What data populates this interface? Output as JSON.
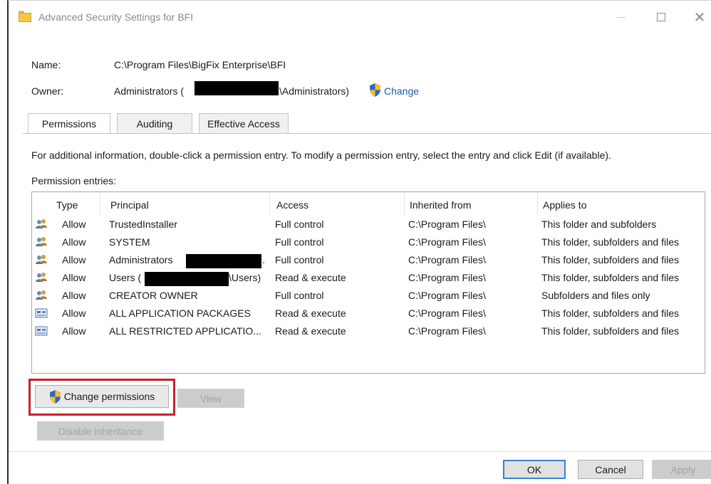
{
  "window": {
    "title": "Advanced Security Settings for BFI",
    "controls": {
      "minimize_icon": "minimize-icon",
      "maximize_icon": "maximize-icon",
      "close_icon": "close-icon",
      "close_glyph": "✕"
    }
  },
  "info": {
    "name_label": "Name:",
    "name_value": "C:\\Program Files\\BigFix Enterprise\\BFI",
    "owner_label": "Owner:",
    "owner_prefix": "Administrators (",
    "owner_suffix": "\\Administrators)",
    "change_link": "Change"
  },
  "tabs": [
    {
      "label": "Permissions",
      "selected": true
    },
    {
      "label": "Auditing",
      "selected": false
    },
    {
      "label": "Effective Access",
      "selected": false
    }
  ],
  "instructions": "For additional information, double-click a permission entry. To modify a permission entry, select the entry and click Edit (if available).",
  "entries_label": "Permission entries:",
  "table": {
    "columns": [
      "Type",
      "Principal",
      "Access",
      "Inherited from",
      "Applies to"
    ],
    "rows": [
      {
        "icon": "users-icon",
        "type": "Allow",
        "principal": "TrustedInstaller",
        "access": "Full control",
        "inherited": "C:\\Program Files\\",
        "applies": "This folder and subfolders"
      },
      {
        "icon": "users-icon",
        "type": "Allow",
        "principal": "SYSTEM",
        "access": "Full control",
        "inherited": "C:\\Program Files\\",
        "applies": "This folder, subfolders and files"
      },
      {
        "icon": "users-icon",
        "type": "Allow",
        "principal": "Administrators",
        "principal_suffix": ".",
        "access": "Full control",
        "inherited": "C:\\Program Files\\",
        "applies": "This folder, subfolders and files"
      },
      {
        "icon": "users-icon",
        "type": "Allow",
        "principal": "Users (",
        "principal_suffix": "\\Users)",
        "access": "Read & execute",
        "inherited": "C:\\Program Files\\",
        "applies": "This folder, subfolders and files"
      },
      {
        "icon": "users-icon",
        "type": "Allow",
        "principal": "CREATOR OWNER",
        "access": "Full control",
        "inherited": "C:\\Program Files\\",
        "applies": "Subfolders and files only"
      },
      {
        "icon": "app-packages-icon",
        "type": "Allow",
        "principal": "ALL APPLICATION PACKAGES",
        "access": "Read & execute",
        "inherited": "C:\\Program Files\\",
        "applies": "This folder, subfolders and files"
      },
      {
        "icon": "app-packages-icon",
        "type": "Allow",
        "principal": "ALL RESTRICTED APPLICATIO...",
        "access": "Read & execute",
        "inherited": "C:\\Program Files\\",
        "applies": "This folder, subfolders and files"
      }
    ]
  },
  "buttons": {
    "change_permissions": "Change permissions",
    "view": "View",
    "disable_inheritance": "Disable inheritance",
    "ok": "OK",
    "cancel": "Cancel",
    "apply": "Apply"
  },
  "colors": {
    "link": "#1a5fb4",
    "highlight": "#c8202a",
    "ok_border": "#3b7ed8",
    "redaction": "#000000"
  }
}
